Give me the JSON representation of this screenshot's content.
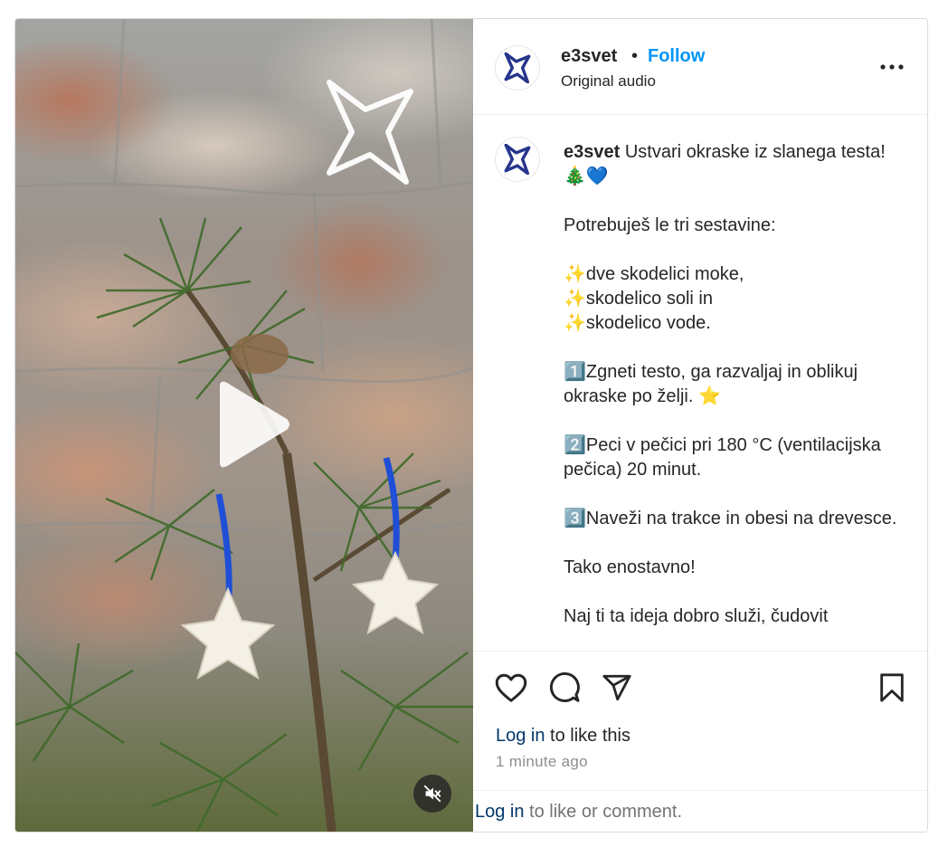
{
  "post": {
    "username": "e3svet",
    "separator": "•",
    "follow_label": "Follow",
    "audio_label": "Original audio",
    "caption_text": "Ustvari okraske iz slanega testa! 🎄💙\n\nPotrebuješ le tri sestavine:\n\n✨dve skodelici moke,\n✨skodelico soli in\n✨skodelico vode.\n\n1️⃣Zgneti testo, ga razvaljaj in oblikuj okraske po želji. ⭐\n\n2️⃣Peci v pečici pri 180 °C (ventilacijska pečica) 20 minut.\n\n3️⃣Naveži na trakce in obesi na drevesce.\n\nTako enostavno!\n\nNaj ti ta ideja dobro služi, čudovit",
    "login_link": "Log in",
    "like_suffix": " to like this",
    "timestamp": "1 minute ago",
    "footer_login": "Log in",
    "footer_suffix": " to like or comment."
  },
  "icons": {
    "avatar": "e3svet-star-logo",
    "play": "play-icon",
    "mute": "muted-speaker-icon",
    "more": "more-options-icon",
    "like": "heart-icon",
    "comment": "comment-bubble-icon",
    "share": "paper-plane-icon",
    "save": "bookmark-icon"
  },
  "colors": {
    "follow": "#0095f6",
    "link": "#00376b",
    "muted_text": "#8e8e8e",
    "logo_blue": "#26358c"
  }
}
